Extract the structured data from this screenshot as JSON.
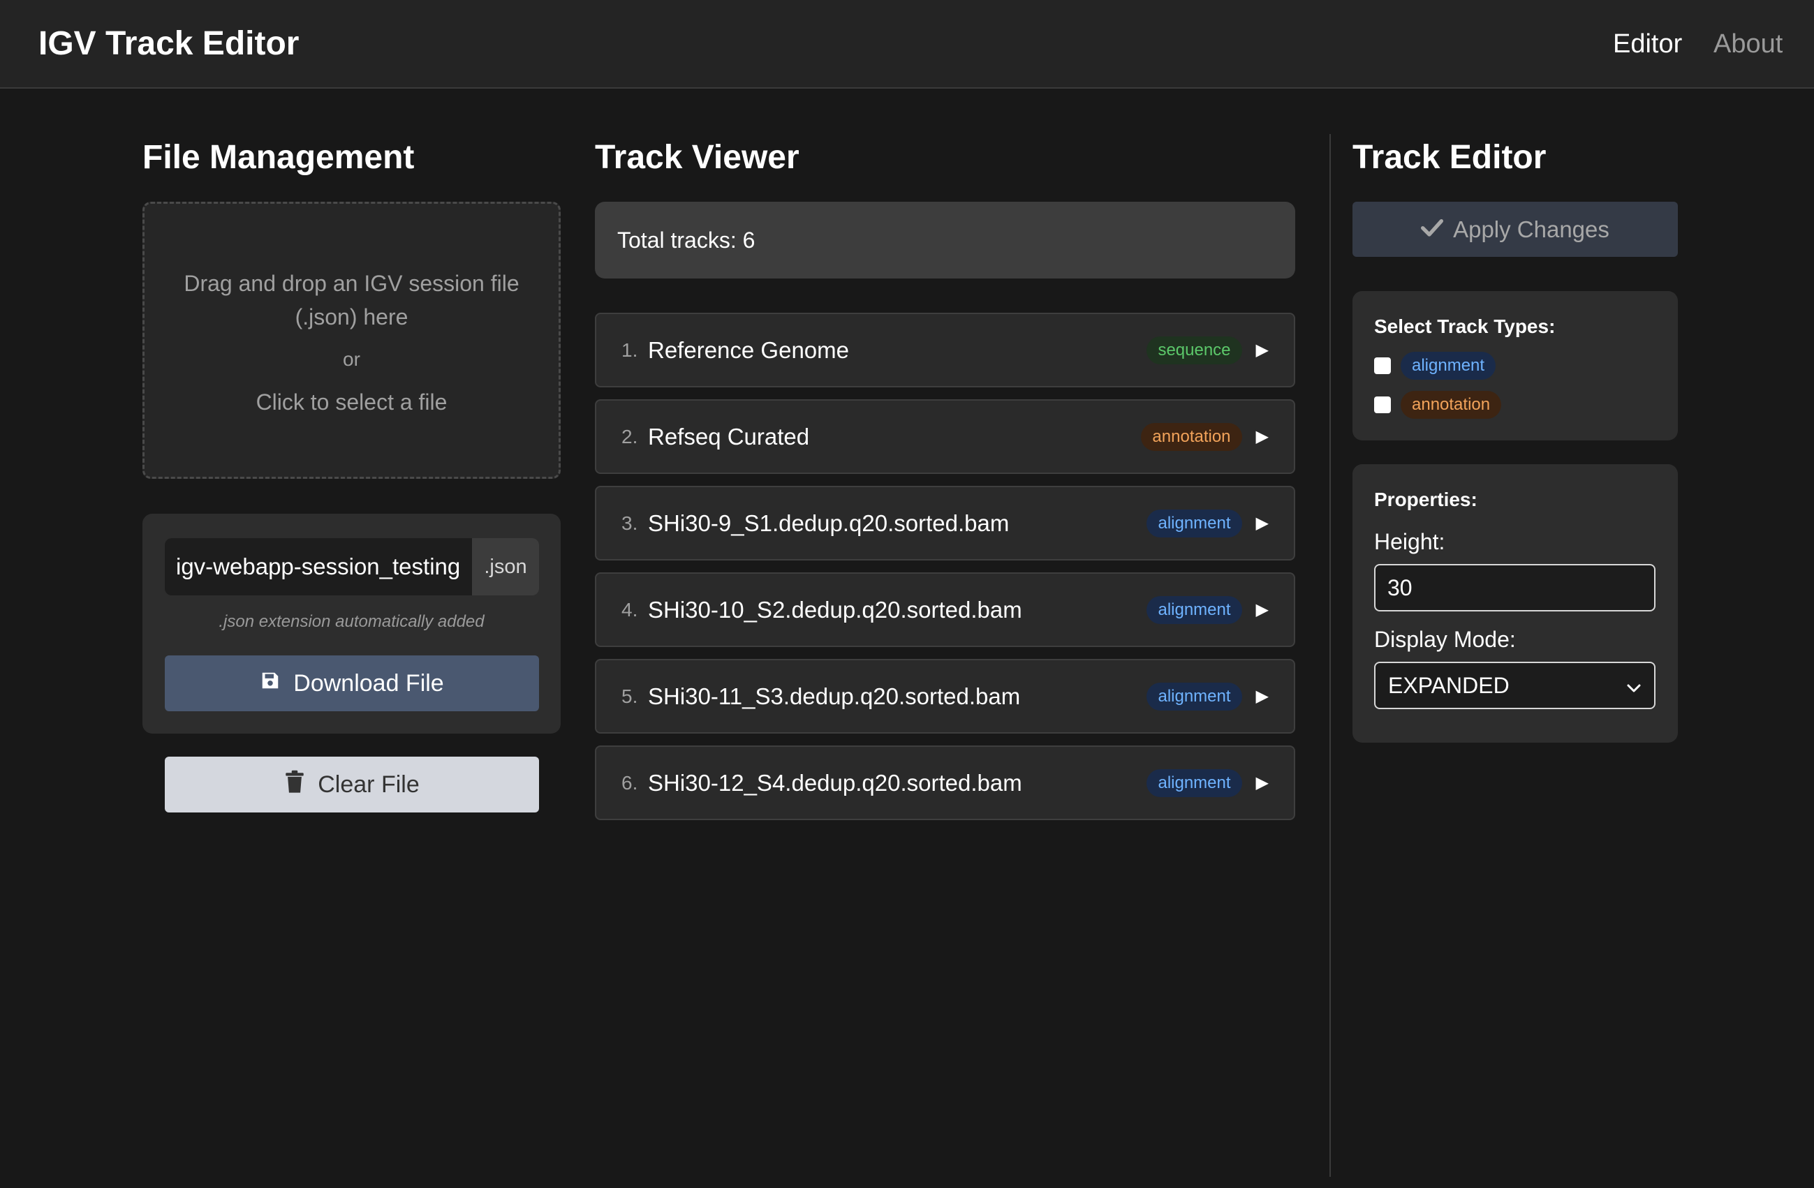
{
  "header": {
    "title": "IGV Track Editor",
    "nav": {
      "editor": "Editor",
      "about": "About"
    }
  },
  "file_management": {
    "title": "File Management",
    "dropzone": {
      "line1": "Drag and drop an IGV session file (.json) here",
      "or": "or",
      "click": "Click to select a file"
    },
    "filename_value": "igv-webapp-session_testing",
    "extension": ".json",
    "extension_hint": ".json extension automatically added",
    "download_label": "Download File",
    "clear_label": "Clear File"
  },
  "track_viewer": {
    "title": "Track Viewer",
    "total": "Total tracks: 6",
    "tracks": [
      {
        "num": "1.",
        "name": "Reference Genome",
        "type": "sequence"
      },
      {
        "num": "2.",
        "name": "Refseq Curated",
        "type": "annotation"
      },
      {
        "num": "3.",
        "name": "SHi30-9_S1.dedup.q20.sorted.bam",
        "type": "alignment"
      },
      {
        "num": "4.",
        "name": "SHi30-10_S2.dedup.q20.sorted.bam",
        "type": "alignment"
      },
      {
        "num": "5.",
        "name": "SHi30-11_S3.dedup.q20.sorted.bam",
        "type": "alignment"
      },
      {
        "num": "6.",
        "name": "SHi30-12_S4.dedup.q20.sorted.bam",
        "type": "alignment"
      }
    ],
    "expand_glyph": "▶"
  },
  "track_editor": {
    "title": "Track Editor",
    "apply_label": "Apply Changes",
    "types_heading": "Select Track Types:",
    "types": [
      {
        "label": "alignment",
        "checked": false
      },
      {
        "label": "annotation",
        "checked": false
      }
    ],
    "properties_heading": "Properties:",
    "height_label": "Height:",
    "height_value": "30",
    "display_mode_label": "Display Mode:",
    "display_mode_value": "EXPANDED"
  },
  "colors": {
    "background": "#181818",
    "sequence": "#5cc86a",
    "annotation": "#f2a35a",
    "alignment": "#6fb3ff",
    "download_button": "#4a5870"
  },
  "icons": {
    "download": "floppy-disk-icon",
    "clear": "trash-icon",
    "apply": "check-icon",
    "select": "chevron-down-icon",
    "expand": "play-triangle-icon"
  }
}
